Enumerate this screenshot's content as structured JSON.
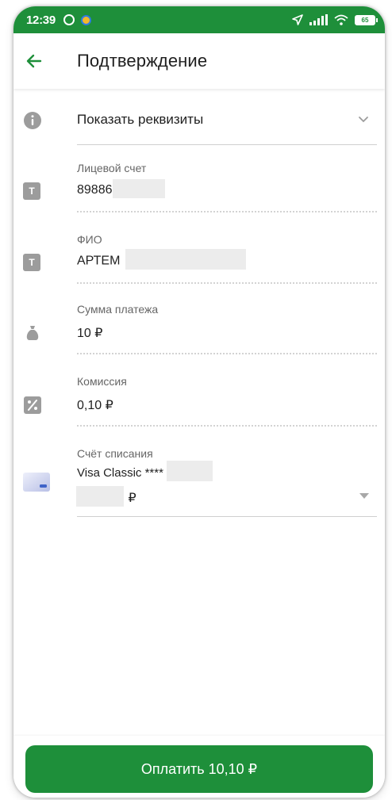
{
  "status_bar": {
    "time": "12:39",
    "battery": "65",
    "accent": "#1e8f3a"
  },
  "header": {
    "title": "Подтверждение"
  },
  "details_toggle": {
    "label": "Показать реквизиты"
  },
  "fields": {
    "account": {
      "label": "Лицевой счет",
      "value": "89886"
    },
    "name": {
      "label": "ФИО",
      "value": "АРТЕМ"
    },
    "amount": {
      "label": "Сумма платежа",
      "value": "10 ₽"
    },
    "commission": {
      "label": "Комиссия",
      "value": "0,10 ₽"
    },
    "debit_account": {
      "label": "Счёт списания",
      "card_name": "Visa Classic ****",
      "currency": "₽"
    }
  },
  "footer": {
    "pay_label": "Оплатить 10,10 ₽"
  }
}
